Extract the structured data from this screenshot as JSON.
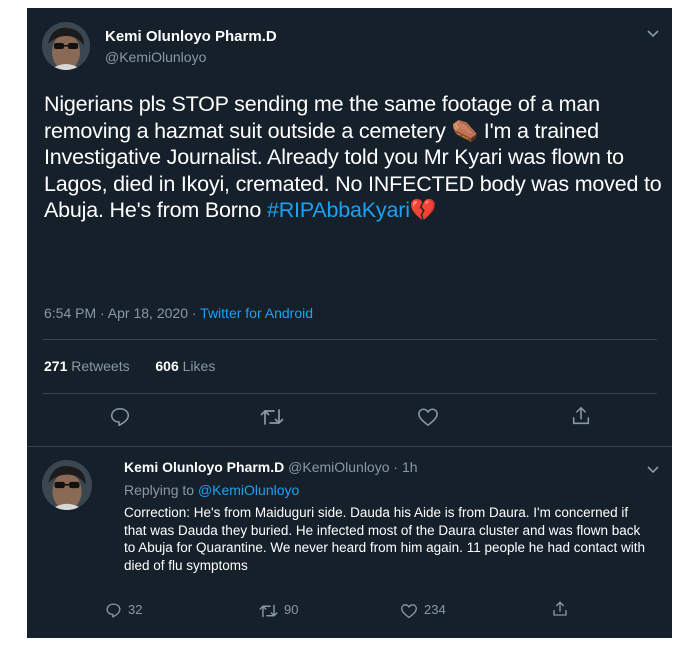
{
  "tweet": {
    "author_name": "Kemi Olunloyo Pharm.D",
    "author_handle": "@KemiOlunloyo",
    "text_main": "Nigerians pls STOP sending me the same footage of a man removing a hazmat suit outside a cemetery ⚰️ I'm a trained Investigative Journalist. Already told you Mr Kyari was flown to Lagos, died in Ikoyi, cremated. No INFECTED body was moved to Abuja. He's from Borno ",
    "hashtag": "#RIPAbbaKyari",
    "hashtag_emoji": "💔",
    "timestamp": "6:54 PM · Apr 18, 2020 · ",
    "source": "Twitter for Android",
    "retweets_count": "271",
    "retweets_label": "Retweets",
    "likes_count": "606",
    "likes_label": "Likes",
    "icons": [
      "reply-icon",
      "retweet-icon",
      "like-icon",
      "share-icon"
    ]
  },
  "reply": {
    "author_name": "Kemi Olunloyo Pharm.D",
    "author_handle_time": "@KemiOlunloyo · 1h",
    "replying_prefix": "Replying to ",
    "replying_handle": "@KemiOlunloyo",
    "text": "Correction: He's from Maiduguri side. Dauda his Aide is from Daura. I'm concerned if that was Dauda they buried. He infected most of the Daura cluster and was flown back to Abuja for Quarantine. We never heard from him again. 11 people he had contact with died of flu symptoms",
    "reply_count": "32",
    "retweet_count": "90",
    "like_count": "234"
  },
  "colors": {
    "background": "#15202b",
    "text": "#ffffff",
    "secondary": "#8899a6",
    "accent": "#1da1f2",
    "divider": "#38444d"
  }
}
